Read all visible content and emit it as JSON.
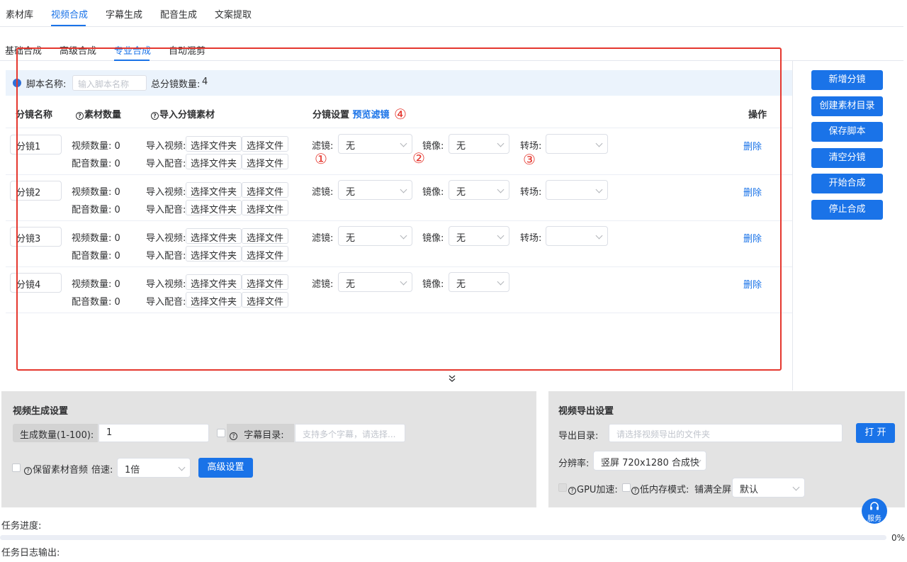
{
  "top_tabs": [
    "素材库",
    "视频合成",
    "字幕生成",
    "配音生成",
    "文案提取"
  ],
  "sub_tabs": [
    "基础合成",
    "高级合成",
    "专业合成",
    "自动混剪"
  ],
  "script": {
    "name_label": "脚本名称:",
    "name_placeholder": "输入脚本名称",
    "total_label": "总分镜数量:",
    "total_value": "4"
  },
  "table_head": {
    "col_name": "分镜名称",
    "col_material": "素材数量",
    "col_import": "导入分镜素材",
    "col_settings": "分镜设置",
    "preview_filter": "预览滤镜",
    "col_action": "操作"
  },
  "rows": [
    {
      "name": "分镜1",
      "video_count": "视频数量: 0",
      "audio_count": "配音数量: 0",
      "import_video": "导入视频:",
      "import_audio": "导入配音:",
      "folder_btn": "选择文件夹",
      "file_btn": "选择文件",
      "filter_label": "滤镜:",
      "filter_value": "无",
      "mirror_label": "镜像:",
      "mirror_value": "无",
      "transition_label": "转场:",
      "transition_value": "",
      "delete": "删除"
    },
    {
      "name": "分镜2",
      "video_count": "视频数量: 0",
      "audio_count": "配音数量: 0",
      "import_video": "导入视频:",
      "import_audio": "导入配音:",
      "folder_btn": "选择文件夹",
      "file_btn": "选择文件",
      "filter_label": "滤镜:",
      "filter_value": "无",
      "mirror_label": "镜像:",
      "mirror_value": "无",
      "transition_label": "转场:",
      "transition_value": "",
      "delete": "删除"
    },
    {
      "name": "分镜3",
      "video_count": "视频数量: 0",
      "audio_count": "配音数量: 0",
      "import_video": "导入视频:",
      "import_audio": "导入配音:",
      "folder_btn": "选择文件夹",
      "file_btn": "选择文件",
      "filter_label": "滤镜:",
      "filter_value": "无",
      "mirror_label": "镜像:",
      "mirror_value": "无",
      "transition_label": "转场:",
      "transition_value": "",
      "delete": "删除"
    },
    {
      "name": "分镜4",
      "video_count": "视频数量: 0",
      "audio_count": "配音数量: 0",
      "import_video": "导入视频:",
      "import_audio": "导入配音:",
      "folder_btn": "选择文件夹",
      "file_btn": "选择文件",
      "filter_label": "滤镜:",
      "filter_value": "无",
      "mirror_label": "镜像:",
      "mirror_value": "无",
      "delete": "删除"
    }
  ],
  "annotations": [
    "①",
    "②",
    "③",
    "④"
  ],
  "side_buttons": [
    "新增分镜",
    "创建素材目录",
    "保存脚本",
    "清空分镜",
    "开始合成",
    "停止合成"
  ],
  "gen_settings": {
    "title": "视频生成设置",
    "count_label": "生成数量(1-100):",
    "count_value": "1",
    "subtitle_label": "字幕目录:",
    "subtitle_placeholder": "支持多个字幕，请选择...",
    "keep_audio_label": "保留素材音频",
    "speed_label": "倍速:",
    "speed_value": "1倍",
    "advanced_button": "高级设置"
  },
  "export_settings": {
    "title": "视频导出设置",
    "dir_label": "导出目录:",
    "dir_placeholder": "请选择视频导出的文件夹",
    "open_button": "打 开",
    "resolution_label": "分辨率:",
    "resolution_value": "竖屏 720x1280 合成快",
    "gpu_label": "GPU加速:",
    "low_mem_label": "低内存模式:",
    "fill_label": "铺满全屏:",
    "fill_value": "默认"
  },
  "service_label": "服务",
  "progress_label": "任务进度:",
  "progress_value": "0%",
  "log_label": "任务日志输出:",
  "colors": {
    "accent": "#1a73e8",
    "annotation": "#e5372e",
    "panel_bg": "#e3e3e3",
    "info_bar": "#ebf3fc"
  }
}
